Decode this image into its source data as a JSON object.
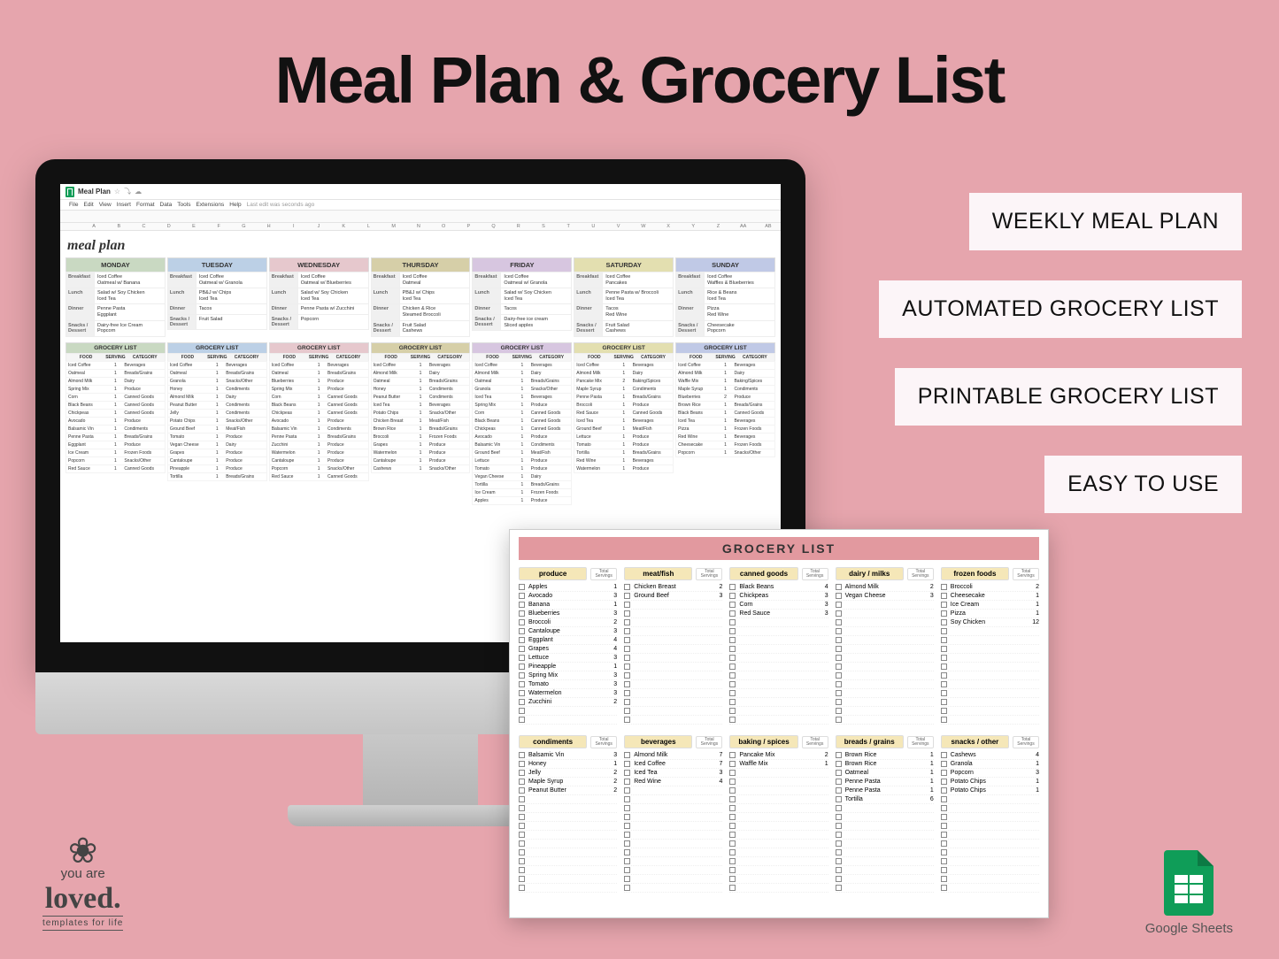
{
  "headline": "Meal Plan & Grocery List",
  "features": [
    "WEEKLY MEAL PLAN",
    "AUTOMATED GROCERY LIST",
    "PRINTABLE GROCERY LIST",
    "EASY TO USE"
  ],
  "brand": {
    "line1": "you are",
    "loved": "loved.",
    "tagline": "templates for life"
  },
  "sheets_logo_caption": "Google Sheets",
  "sheet": {
    "doc_title": "Meal Plan",
    "menu": [
      "File",
      "Edit",
      "View",
      "Insert",
      "Format",
      "Data",
      "Tools",
      "Extensions",
      "Help"
    ],
    "last_edit": "Last edit was seconds ago",
    "columns": [
      "",
      "A",
      "B",
      "C",
      "D",
      "E",
      "F",
      "G",
      "H",
      "I",
      "J",
      "K",
      "L",
      "M",
      "N",
      "O",
      "P",
      "Q",
      "R",
      "S",
      "T",
      "U",
      "V",
      "W",
      "X",
      "Y",
      "Z",
      "AA",
      "AB"
    ],
    "plan_title": "meal plan",
    "days": [
      "MONDAY",
      "TUESDAY",
      "WEDNESDAY",
      "THURSDAY",
      "FRIDAY",
      "SATURDAY",
      "SUNDAY"
    ],
    "day_colors": [
      "#c9d9c2",
      "#bcd0e6",
      "#e6c8cd",
      "#d6cfa8",
      "#d7c6e0",
      "#e3dfb0",
      "#c0c9e6"
    ],
    "meal_labels": [
      "Breakfast",
      "Lunch",
      "Dinner",
      "Snacks / Dessert"
    ],
    "plan": {
      "MONDAY": [
        "Iced Coffee\nOatmeal w/ Banana",
        "Salad w/ Soy Chicken\nIced Tea",
        "Penne Pasta\nEggplant",
        "Dairy-free Ice Cream\nPopcorn"
      ],
      "TUESDAY": [
        "Iced Coffee\nOatmeal w/ Granola",
        "PB&J w/ Chips\nIced Tea",
        "Tacos",
        "Fruit Salad"
      ],
      "WEDNESDAY": [
        "Iced Coffee\nOatmeal w/ Blueberries",
        "Salad w/ Soy Chicken\nIced Tea",
        "Penne Pasta w/ Zucchini",
        "Popcorn"
      ],
      "THURSDAY": [
        "Iced Coffee\nOatmeal",
        "PB&J w/ Chips\nIced Tea",
        "Chicken & Rice\nSteamed Broccoli",
        "Fruit Salad\nCashews"
      ],
      "FRIDAY": [
        "Iced Coffee\nOatmeal w/ Granola",
        "Salad w/ Soy Chicken\nIced Tea",
        "Tacos",
        "Dairy-free ice cream\nSliced apples"
      ],
      "SATURDAY": [
        "Iced Coffee\nPancakes",
        "Penne Pasta w/ Broccoli\nIced Tea",
        "Tacos\nRed Wine",
        "Fruit Salad\nCashews"
      ],
      "SUNDAY": [
        "Iced Coffee\nWaffles & Blueberries",
        "Rice & Beans\nIced Tea",
        "Pizza\nRed Wine",
        "Cheesecake\nPopcorn"
      ]
    },
    "grocery_header": "GROCERY LIST",
    "grocery_sub": [
      "FOOD",
      "SERVING",
      "CATEGORY"
    ],
    "grocery_colors": [
      "#c9d9c2",
      "#bcd0e6",
      "#e6c8cd",
      "#d6cfa8",
      "#d7c6e0",
      "#e3dfb0",
      "#c0c9e6"
    ],
    "grocery": {
      "MONDAY": [
        [
          "Iced Coffee",
          "1",
          "Beverages"
        ],
        [
          "Oatmeal",
          "1",
          "Breads/Grains"
        ],
        [
          "Almond Milk",
          "1",
          "Dairy"
        ],
        [
          "Spring Mix",
          "1",
          "Produce"
        ],
        [
          "Corn",
          "1",
          "Canned Goods"
        ],
        [
          "Black Beans",
          "1",
          "Canned Goods"
        ],
        [
          "Chickpeas",
          "1",
          "Canned Goods"
        ],
        [
          "Avocado",
          "1",
          "Produce"
        ],
        [
          "Balsamic Vin",
          "1",
          "Condiments"
        ],
        [
          "Penne Pasta",
          "1",
          "Breads/Grains"
        ],
        [
          "Eggplant",
          "1",
          "Produce"
        ],
        [
          "Ice Cream",
          "1",
          "Frozen Foods"
        ],
        [
          "Popcorn",
          "1",
          "Snacks/Other"
        ],
        [
          "Red Sauce",
          "1",
          "Canned Goods"
        ]
      ],
      "TUESDAY": [
        [
          "Iced Coffee",
          "1",
          "Beverages"
        ],
        [
          "Oatmeal",
          "1",
          "Breads/Grains"
        ],
        [
          "Granola",
          "1",
          "Snacks/Other"
        ],
        [
          "Honey",
          "1",
          "Condiments"
        ],
        [
          "Almond Milk",
          "1",
          "Dairy"
        ],
        [
          "Peanut Butter",
          "1",
          "Condiments"
        ],
        [
          "Jelly",
          "1",
          "Condiments"
        ],
        [
          "Potato Chips",
          "1",
          "Snacks/Other"
        ],
        [
          "Ground Beef",
          "1",
          "Meat/Fish"
        ],
        [
          "Tomato",
          "1",
          "Produce"
        ],
        [
          "Vegan Cheese",
          "1",
          "Dairy"
        ],
        [
          "Grapes",
          "1",
          "Produce"
        ],
        [
          "Cantaloupe",
          "1",
          "Produce"
        ],
        [
          "Pineapple",
          "1",
          "Produce"
        ],
        [
          "Tortilla",
          "1",
          "Breads/Grains"
        ]
      ],
      "WEDNESDAY": [
        [
          "Iced Coffee",
          "1",
          "Beverages"
        ],
        [
          "Oatmeal",
          "1",
          "Breads/Grains"
        ],
        [
          "Blueberries",
          "1",
          "Produce"
        ],
        [
          "Spring Mix",
          "1",
          "Produce"
        ],
        [
          "Corn",
          "1",
          "Canned Goods"
        ],
        [
          "Black Beans",
          "1",
          "Canned Goods"
        ],
        [
          "Chickpeas",
          "1",
          "Canned Goods"
        ],
        [
          "Avocado",
          "1",
          "Produce"
        ],
        [
          "Balsamic Vin",
          "1",
          "Condiments"
        ],
        [
          "Penne Pasta",
          "1",
          "Breads/Grains"
        ],
        [
          "Zucchini",
          "1",
          "Produce"
        ],
        [
          "Watermelon",
          "1",
          "Produce"
        ],
        [
          "Cantaloupe",
          "1",
          "Produce"
        ],
        [
          "Popcorn",
          "1",
          "Snacks/Other"
        ],
        [
          "Red Sauce",
          "1",
          "Canned Goods"
        ]
      ],
      "THURSDAY": [
        [
          "Iced Coffee",
          "1",
          "Beverages"
        ],
        [
          "Almond Milk",
          "1",
          "Dairy"
        ],
        [
          "Oatmeal",
          "1",
          "Breads/Grains"
        ],
        [
          "Honey",
          "1",
          "Condiments"
        ],
        [
          "Peanut Butter",
          "1",
          "Condiments"
        ],
        [
          "Iced Tea",
          "1",
          "Beverages"
        ],
        [
          "Potato Chips",
          "1",
          "Snacks/Other"
        ],
        [
          "Chicken Breast",
          "1",
          "Meat/Fish"
        ],
        [
          "Brown Rice",
          "1",
          "Breads/Grains"
        ],
        [
          "Broccoli",
          "1",
          "Frozen Foods"
        ],
        [
          "Grapes",
          "1",
          "Produce"
        ],
        [
          "Watermelon",
          "1",
          "Produce"
        ],
        [
          "Cantaloupe",
          "1",
          "Produce"
        ],
        [
          "Cashews",
          "1",
          "Snacks/Other"
        ]
      ],
      "FRIDAY": [
        [
          "Iced Coffee",
          "1",
          "Beverages"
        ],
        [
          "Almond Milk",
          "1",
          "Dairy"
        ],
        [
          "Oatmeal",
          "1",
          "Breads/Grains"
        ],
        [
          "Granola",
          "1",
          "Snacks/Other"
        ],
        [
          "Iced Tea",
          "1",
          "Beverages"
        ],
        [
          "Spring Mix",
          "1",
          "Produce"
        ],
        [
          "Corn",
          "1",
          "Canned Goods"
        ],
        [
          "Black Beans",
          "1",
          "Canned Goods"
        ],
        [
          "Chickpeas",
          "1",
          "Canned Goods"
        ],
        [
          "Avocado",
          "1",
          "Produce"
        ],
        [
          "Balsamic Vin",
          "1",
          "Condiments"
        ],
        [
          "Ground Beef",
          "1",
          "Meat/Fish"
        ],
        [
          "Lettuce",
          "1",
          "Produce"
        ],
        [
          "Tomato",
          "1",
          "Produce"
        ],
        [
          "Vegan Cheese",
          "1",
          "Dairy"
        ],
        [
          "Tortilla",
          "1",
          "Breads/Grains"
        ],
        [
          "Ice Cream",
          "1",
          "Frozen Foods"
        ],
        [
          "Apples",
          "1",
          "Produce"
        ]
      ],
      "SATURDAY": [
        [
          "Iced Coffee",
          "1",
          "Beverages"
        ],
        [
          "Almond Milk",
          "1",
          "Dairy"
        ],
        [
          "Pancake Mix",
          "2",
          "Baking/Spices"
        ],
        [
          "Maple Syrup",
          "1",
          "Condiments"
        ],
        [
          "Penne Pasta",
          "1",
          "Breads/Grains"
        ],
        [
          "Broccoli",
          "1",
          "Produce"
        ],
        [
          "Red Sauce",
          "1",
          "Canned Goods"
        ],
        [
          "Iced Tea",
          "1",
          "Beverages"
        ],
        [
          "Ground Beef",
          "1",
          "Meat/Fish"
        ],
        [
          "Lettuce",
          "1",
          "Produce"
        ],
        [
          "Tomato",
          "1",
          "Produce"
        ],
        [
          "Tortilla",
          "1",
          "Breads/Grains"
        ],
        [
          "Red Wine",
          "1",
          "Beverages"
        ],
        [
          "Watermelon",
          "1",
          "Produce"
        ]
      ],
      "SUNDAY": [
        [
          "Iced Coffee",
          "1",
          "Beverages"
        ],
        [
          "Almond Milk",
          "1",
          "Dairy"
        ],
        [
          "Waffle Mix",
          "1",
          "Baking/Spices"
        ],
        [
          "Maple Syrup",
          "1",
          "Condiments"
        ],
        [
          "Blueberries",
          "2",
          "Produce"
        ],
        [
          "Brown Rice",
          "1",
          "Breads/Grains"
        ],
        [
          "Black Beans",
          "1",
          "Canned Goods"
        ],
        [
          "Iced Tea",
          "1",
          "Beverages"
        ],
        [
          "Pizza",
          "1",
          "Frozen Foods"
        ],
        [
          "Red Wine",
          "1",
          "Beverages"
        ],
        [
          "Cheesecake",
          "1",
          "Frozen Foods"
        ],
        [
          "Popcorn",
          "1",
          "Snacks/Other"
        ]
      ]
    }
  },
  "print": {
    "title": "GROCERY LIST",
    "sections_top": [
      {
        "name": "produce",
        "items": [
          [
            "Apples",
            "1"
          ],
          [
            "Avocado",
            "3"
          ],
          [
            "Banana",
            "1"
          ],
          [
            "Blueberries",
            "3"
          ],
          [
            "Broccoli",
            "2"
          ],
          [
            "Cantaloupe",
            "3"
          ],
          [
            "Eggplant",
            "4"
          ],
          [
            "Grapes",
            "4"
          ],
          [
            "Lettuce",
            "3"
          ],
          [
            "Pineapple",
            "1"
          ],
          [
            "Spring Mix",
            "3"
          ],
          [
            "Tomato",
            "3"
          ],
          [
            "Watermelon",
            "3"
          ],
          [
            "Zucchini",
            "2"
          ]
        ]
      },
      {
        "name": "meat/fish",
        "items": [
          [
            "Chicken Breast",
            "2"
          ],
          [
            "Ground Beef",
            "3"
          ]
        ]
      },
      {
        "name": "canned goods",
        "items": [
          [
            "Black Beans",
            "4"
          ],
          [
            "Chickpeas",
            "3"
          ],
          [
            "Corn",
            "3"
          ],
          [
            "Red Sauce",
            "3"
          ]
        ]
      },
      {
        "name": "dairy / milks",
        "items": [
          [
            "Almond Milk",
            "2"
          ],
          [
            "Vegan Cheese",
            "3"
          ]
        ]
      },
      {
        "name": "frozen foods",
        "items": [
          [
            "Broccoli",
            "2"
          ],
          [
            "Cheesecake",
            "1"
          ],
          [
            "Ice Cream",
            "1"
          ],
          [
            "Pizza",
            "1"
          ],
          [
            "Soy Chicken",
            "12"
          ]
        ]
      }
    ],
    "sections_bottom": [
      {
        "name": "condiments",
        "items": [
          [
            "Balsamic Vin",
            "3"
          ],
          [
            "Honey",
            "1"
          ],
          [
            "Jelly",
            "2"
          ],
          [
            "Maple Syrup",
            "2"
          ],
          [
            "Peanut Butter",
            "2"
          ]
        ]
      },
      {
        "name": "beverages",
        "items": [
          [
            "Almond Milk",
            "7"
          ],
          [
            "Iced Coffee",
            "7"
          ],
          [
            "Iced Tea",
            "3"
          ],
          [
            "Red Wine",
            "4"
          ]
        ]
      },
      {
        "name": "baking / spices",
        "items": [
          [
            "Pancake Mix",
            "2"
          ],
          [
            "Waffle Mix",
            "1"
          ]
        ]
      },
      {
        "name": "breads / grains",
        "items": [
          [
            "Brown Rice",
            "1"
          ],
          [
            "Brown Rice",
            "1"
          ],
          [
            "Oatmeal",
            "1"
          ],
          [
            "Penne Pasta",
            "1"
          ],
          [
            "Penne Pasta",
            "1"
          ],
          [
            "Tortilla",
            "6"
          ]
        ]
      },
      {
        "name": "snacks / other",
        "items": [
          [
            "Cashews",
            "4"
          ],
          [
            "Granola",
            "1"
          ],
          [
            "Popcorn",
            "3"
          ],
          [
            "Potato Chips",
            "1"
          ],
          [
            "Potato Chips",
            "1"
          ]
        ]
      }
    ],
    "total_label": "Total Servings"
  }
}
